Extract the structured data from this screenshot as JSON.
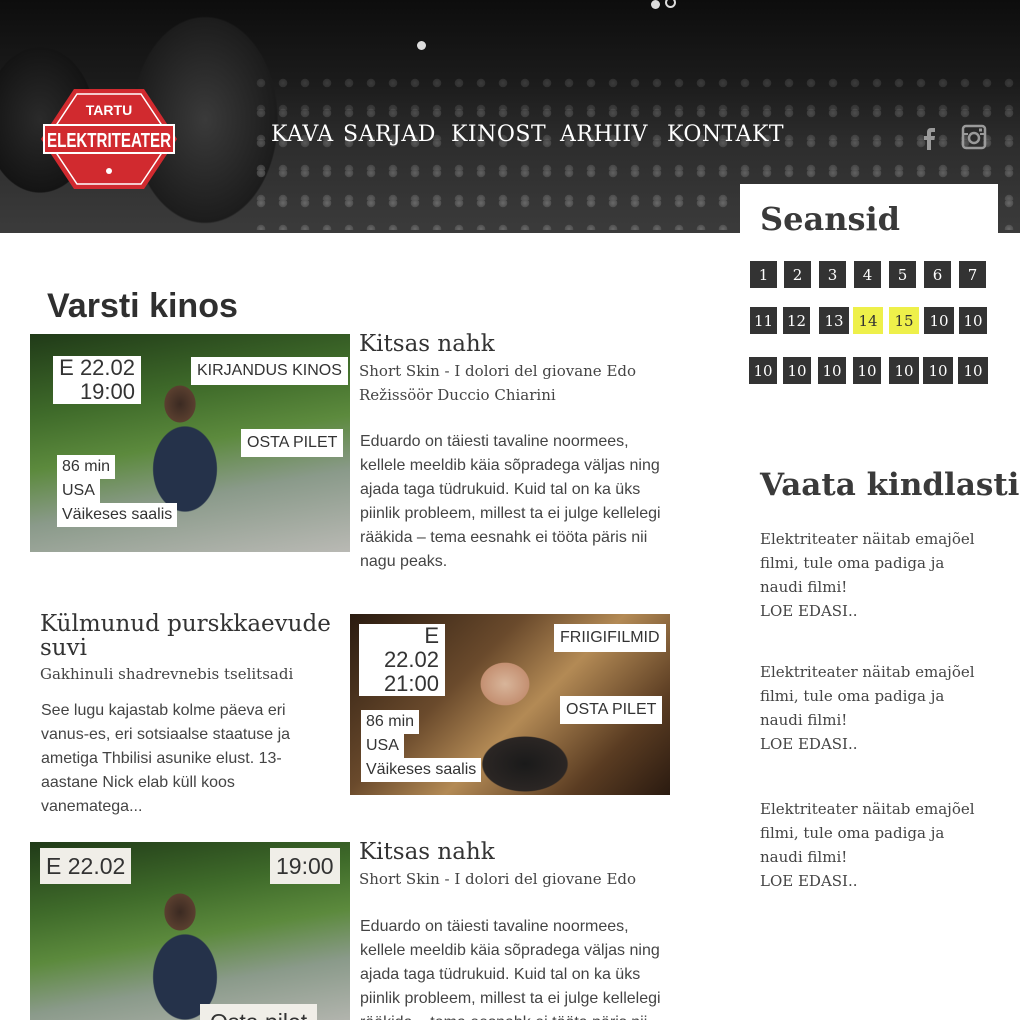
{
  "header": {
    "logo_top": "TARTU",
    "logo_main": "ELEKTRITEATER",
    "nav": [
      "KAVA",
      "SARJAD",
      "KINOST",
      "ARHIIV",
      "KONTAKT"
    ]
  },
  "sidebar": {
    "sessions_title": "Seansid",
    "days_row1": [
      "1",
      "2",
      "3",
      "4",
      "5",
      "6",
      "7"
    ],
    "days_row2": [
      "11",
      "12",
      "13",
      "14",
      "15",
      "10",
      "10"
    ],
    "days_row3": [
      "10",
      "10",
      "10",
      "10",
      "10",
      "10",
      "10"
    ],
    "highlight_color": "#eef04a",
    "watch_title": "Vaata kindlasti",
    "notes": [
      {
        "text": "Elektriteater näitab emajõel filmi, tule oma padiga ja naudi filmi!",
        "more": "LOE EDASI.."
      },
      {
        "text": "Elektriteater näitab emajõel filmi, tule oma padiga ja naudi filmi!",
        "more": "LOE EDASI.."
      },
      {
        "text": "Elektriteater näitab emajõel filmi, tule oma padiga ja naudi filmi!",
        "more": "LOE EDASI.."
      }
    ]
  },
  "main": {
    "section_title": "Varsti kinos",
    "films": [
      {
        "date": "E 22.02",
        "time": "19:00",
        "category": "KIRJANDUS KINOS",
        "buy": "OSTA PILET",
        "duration": "86 min",
        "country": "USA",
        "hall": "Väikeses saalis",
        "title": "Kitsas nahk",
        "original_title": "Short Skin - I dolori del giovane Edo",
        "director": "Režissöör Duccio Chiarini",
        "description": "Eduardo on täiesti tavaline noormees, kellele meeldib käia sõpradega väljas ning ajada taga tüdrukuid. Kuid tal on ka üks piinlik probleem, millest ta ei julge kellelegi rääkida – tema eesnahk ei tööta päris nii nagu peaks."
      },
      {
        "date": "E 22.02",
        "time": "21:00",
        "category": "FRIIGIFILMID",
        "buy": "OSTA PILET",
        "duration": "86 min",
        "country": "USA",
        "hall": "Väikeses saalis",
        "title": "Külmunud purskkaevude suvi",
        "original_title": "Gakhinuli shadrevnebis tselitsadi",
        "description": "See lugu kajastab kolme päeva eri vanus-es, eri sotsiaalse staatuse ja ametiga Thbilisi asunike elust. 13-aastane Nick elab küll koos vanematega..."
      },
      {
        "date": "E 22.02",
        "time": "19:00",
        "buy": "Osta pilet",
        "title": "Kitsas nahk",
        "original_title": "Short Skin - I dolori del giovane Edo",
        "description": "Eduardo on täiesti tavaline noormees, kellele meeldib käia sõpradega väljas ning ajada taga tüdrukuid. Kuid tal on ka üks piinlik probleem, millest ta ei julge kellelegi rääkida – tema eesnahk ei tööta päris nii nagu peaks."
      }
    ]
  }
}
